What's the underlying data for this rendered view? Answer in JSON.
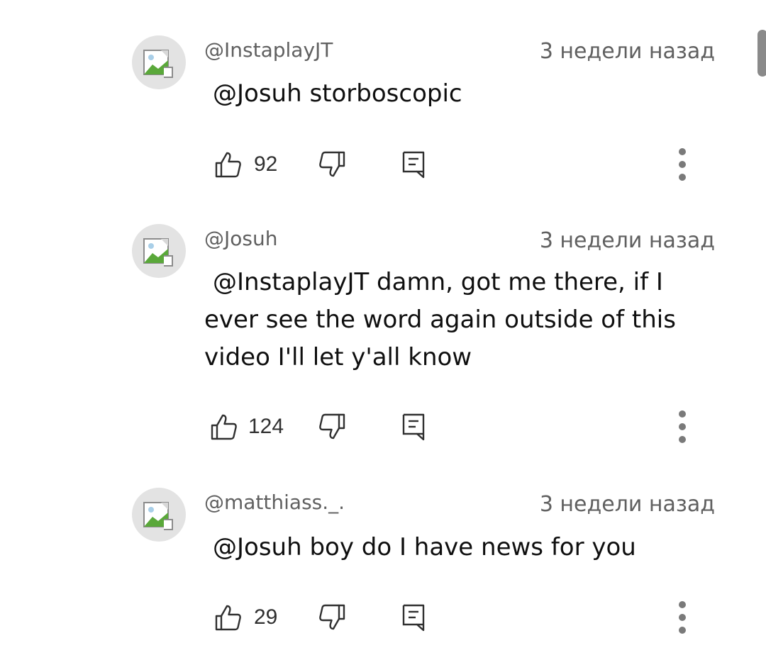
{
  "comments": [
    {
      "author": "@InstaplayJT",
      "time": "3 недели назад",
      "text": "@Josuh storboscopic",
      "likes": "92"
    },
    {
      "author": "@Josuh",
      "time": "3 недели назад",
      "text": "@InstaplayJT  damn, got me there, if I ever see the word again outside of this video I'll let y'all know",
      "likes": "124"
    },
    {
      "author": "@matthiass._.",
      "time": "3 недели назад",
      "text": "@Josuh boy do I have news for you",
      "likes": "29"
    }
  ],
  "icons": {
    "like": "thumbs-up-icon",
    "dislike": "thumbs-down-icon",
    "reply": "reply-icon",
    "more": "more-vert-icon",
    "avatar": "broken-image-icon"
  }
}
